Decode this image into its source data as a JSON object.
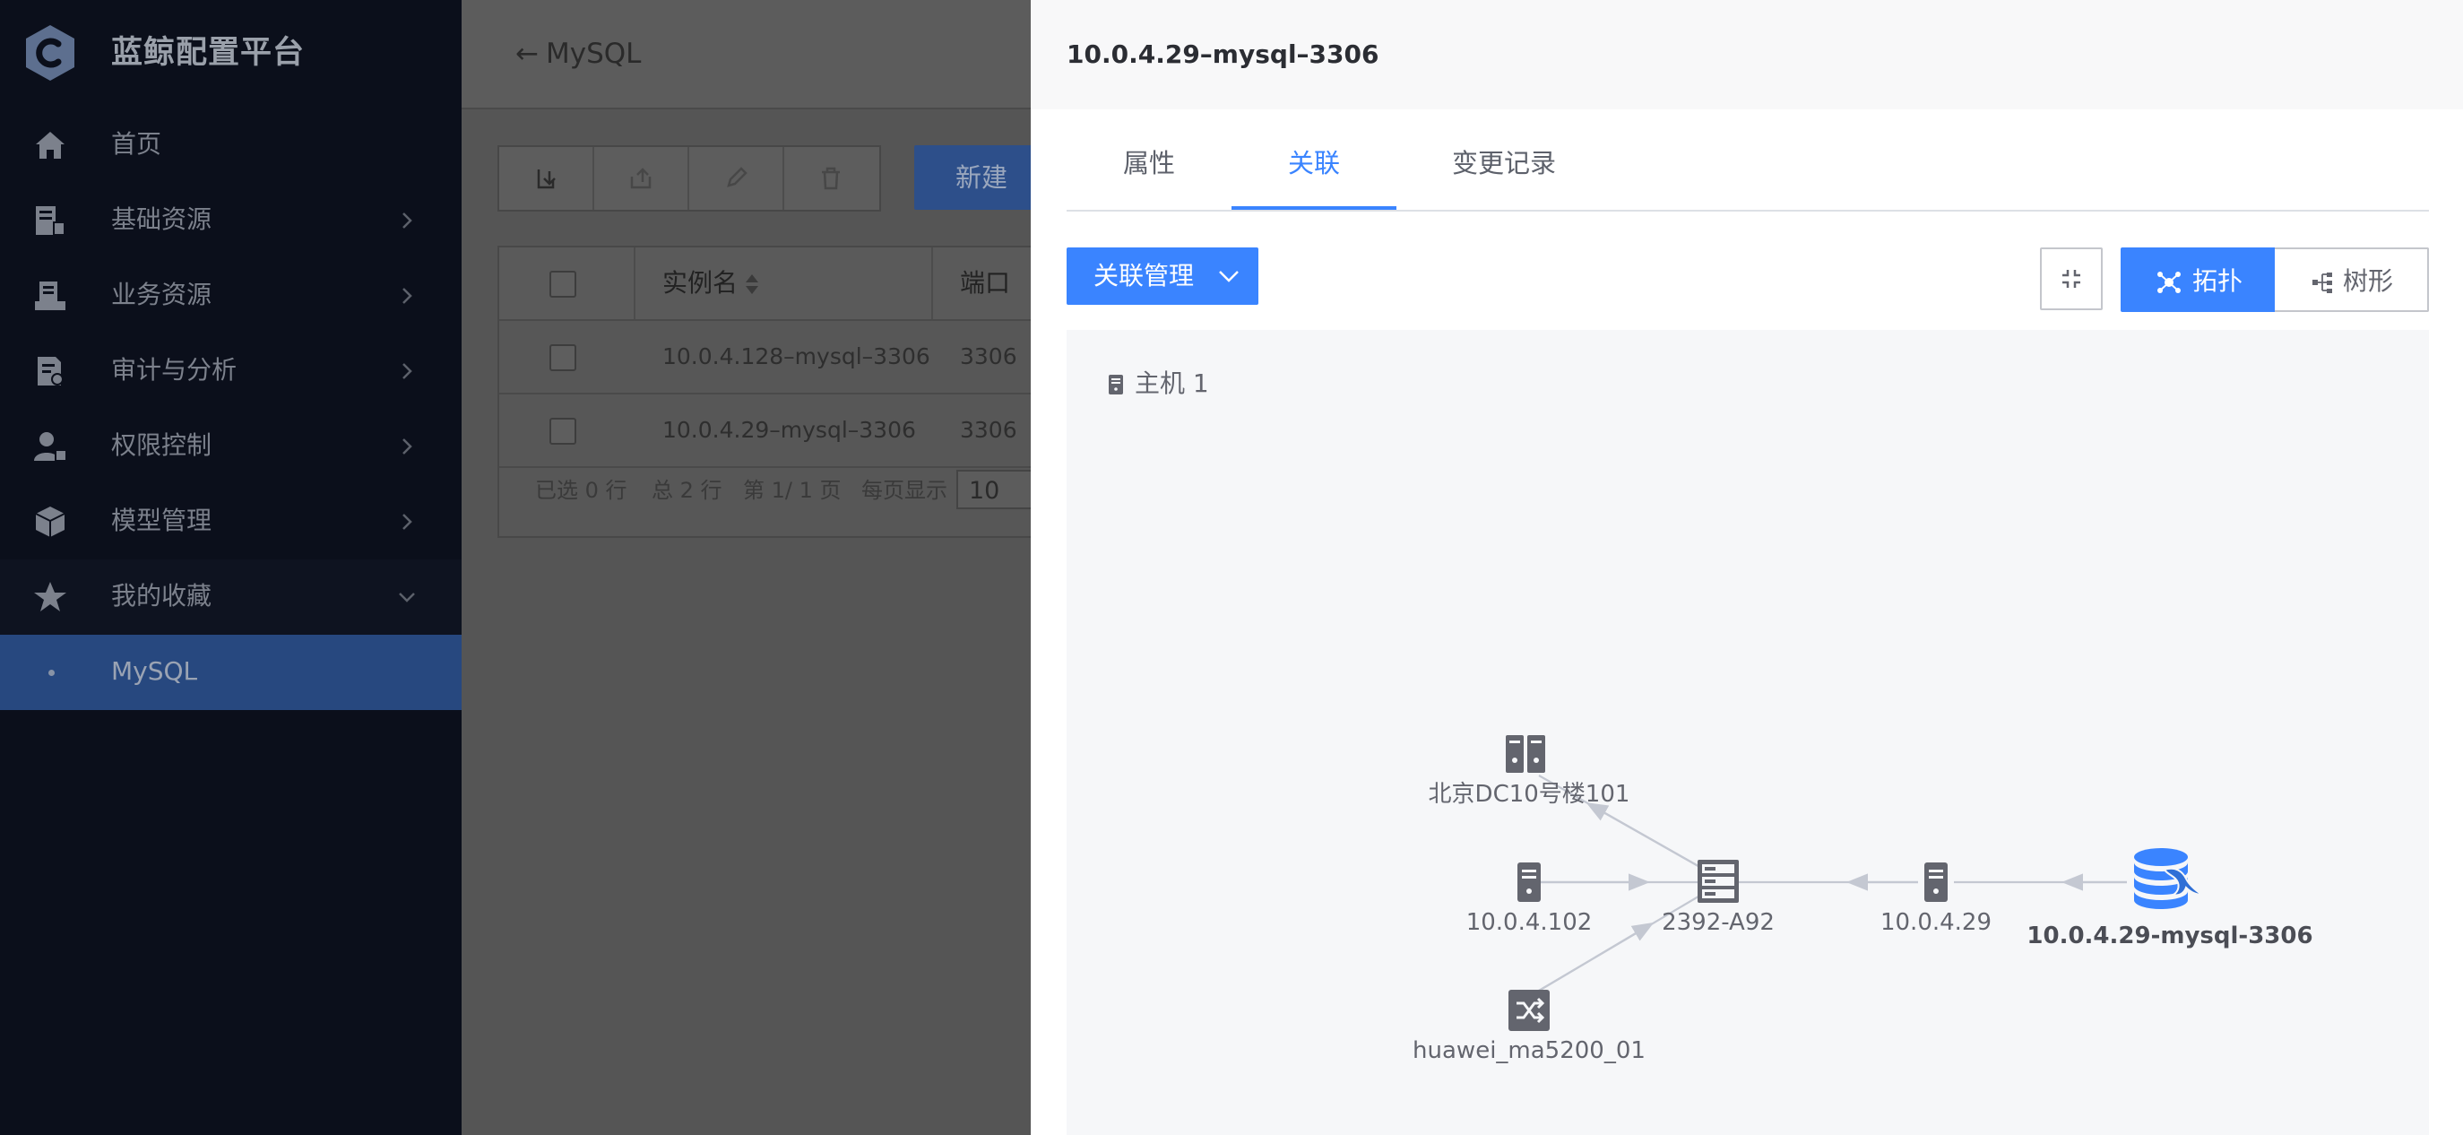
{
  "sidebar": {
    "brand": "蓝鲸配置平台",
    "items": [
      {
        "label": "首页",
        "icon": "home-icon"
      },
      {
        "label": "基础资源",
        "icon": "host-resource-icon"
      },
      {
        "label": "业务资源",
        "icon": "business-resource-icon"
      },
      {
        "label": "审计与分析",
        "icon": "audit-icon"
      },
      {
        "label": "权限控制",
        "icon": "permission-icon"
      },
      {
        "label": "模型管理",
        "icon": "model-cube-icon"
      },
      {
        "label": "我的收藏",
        "icon": "star-icon"
      }
    ],
    "active_child": "MySQL"
  },
  "main": {
    "back_label": "MySQL",
    "new_button": "新建",
    "table": {
      "headers": [
        "实例名",
        "端口"
      ],
      "rows": [
        {
          "name": "10.0.4.128–mysql–3306",
          "port": "3306"
        },
        {
          "name": "10.0.4.29–mysql–3306",
          "port": "3306"
        }
      ]
    },
    "footer": {
      "selected": "已选 0 行",
      "total": "总 2 行",
      "page": "第 1/ 1 页",
      "per_page_label": "每页显示",
      "per_page_value": "10"
    }
  },
  "drawer": {
    "title": "10.0.4.29–mysql–3306",
    "tabs": [
      "属性",
      "关联",
      "变更记录"
    ],
    "active_tab": "关联",
    "relation_button": "关联管理",
    "view_buttons": {
      "topology": "拓扑",
      "tree": "树形"
    },
    "legend": "主机 1",
    "nodes": [
      {
        "id": "idc",
        "label": "北京DC10号楼101",
        "icon": "idc-rack-icon"
      },
      {
        "id": "host102",
        "label": "10.0.4.102",
        "icon": "server-icon"
      },
      {
        "id": "cabinet",
        "label": "2392-A92",
        "icon": "cabinet-icon"
      },
      {
        "id": "switch",
        "label": "huawei_ma5200_01",
        "icon": "switch-icon"
      },
      {
        "id": "host29",
        "label": "10.0.4.29",
        "icon": "server-icon"
      },
      {
        "id": "mysql",
        "label": "10.0.4.29-mysql-3306",
        "icon": "mysql-database-icon"
      }
    ],
    "edges": [
      {
        "from": "host102",
        "to": "cabinet"
      },
      {
        "from": "switch",
        "to": "cabinet"
      },
      {
        "from": "cabinet",
        "to": "idc"
      },
      {
        "from": "host29",
        "to": "cabinet"
      },
      {
        "from": "mysql",
        "to": "host29"
      }
    ],
    "colors": {
      "accent": "#3a84ff",
      "edge": "#c4c8d2",
      "icon": "#63656e"
    }
  }
}
